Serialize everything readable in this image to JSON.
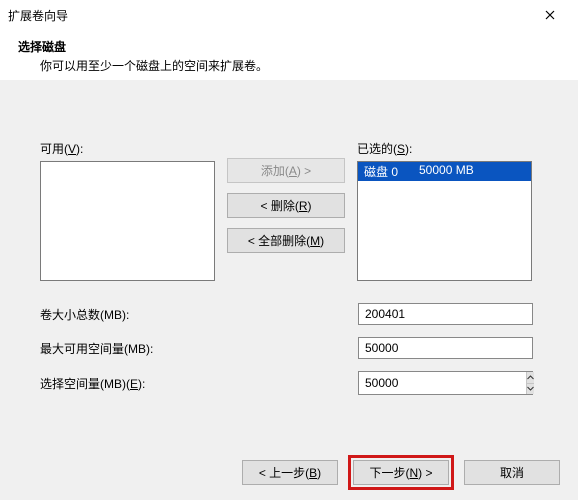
{
  "window": {
    "title": "扩展卷向导",
    "section_title": "选择磁盘",
    "section_desc": "你可以用至少一个磁盘上的空间来扩展卷。"
  },
  "labels": {
    "available": "可用(",
    "available_hk": "V",
    "available_suffix": "):",
    "selected": "已选的(",
    "selected_hk": "S",
    "selected_suffix": "):"
  },
  "buttons": {
    "add_pre": "添加(",
    "add_hk": "A",
    "add_suf": ") >",
    "remove_pre": "< 删除(",
    "remove_hk": "R",
    "remove_suf": ")",
    "remove_all_pre": "< 全部删除(",
    "remove_all_hk": "M",
    "remove_all_suf": ")",
    "back_pre": "< 上一步(",
    "back_hk": "B",
    "back_suf": ")",
    "next_pre": "下一步(",
    "next_hk": "N",
    "next_suf": ") >",
    "cancel": "取消"
  },
  "fields": {
    "total_label": "卷大小总数(MB):",
    "total_value": "200401",
    "max_label": "最大可用空间量(MB):",
    "max_value": "50000",
    "select_pre": "选择空间量(MB)(",
    "select_hk": "E",
    "select_suf": "):",
    "select_value": "50000"
  },
  "selected_items": [
    {
      "name": "磁盘 0",
      "size": "50000 MB"
    }
  ]
}
